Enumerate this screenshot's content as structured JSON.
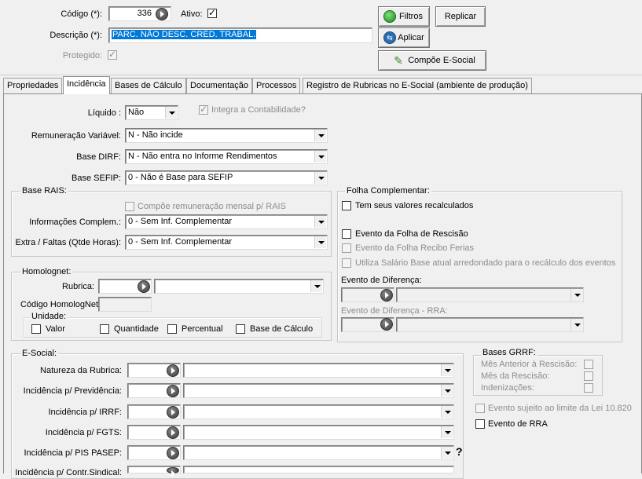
{
  "header": {
    "codigo_label": "Código (*):",
    "codigo_value": "336",
    "ativo_label": "Ativo:",
    "descricao_label": "Descrição (*):",
    "descricao_value": "PARC. NÃO DESC. CRÉD. TRABAL.",
    "protegido_label": "Protegido:"
  },
  "toolbar": {
    "filtros": "Filtros",
    "aplicar": "Aplicar",
    "replicar": "Replicar",
    "compoe": "Compõe E-Social"
  },
  "tabs": [
    {
      "label": "Propriedades"
    },
    {
      "label": "Incidência"
    },
    {
      "label": "Bases de Cálculo"
    },
    {
      "label": "Documentação"
    },
    {
      "label": "Processos"
    },
    {
      "label": "Registro de Rubricas no E-Social (ambiente de produção)"
    }
  ],
  "incidencia": {
    "liquido_label": "Líquido :",
    "liquido_value": "Não",
    "integra_label": "Integra a Contabilidade?",
    "rem_var_label": "Remuneração Variável:",
    "rem_var_value": "N - Não incide",
    "dirf_label": "Base DIRF:",
    "dirf_value": "N - Não entra no Informe Rendimentos",
    "sefip_label": "Base SEFIP:",
    "sefip_value": "0 - Não é Base para SEFIP"
  },
  "rais": {
    "title": "Base RAIS:",
    "compoe_label": "Compõe remuneração mensal p/ RAIS",
    "info_label": "Informações Complem.:",
    "info_value": "0 - Sem Inf. Complementar",
    "extra_label": "Extra / Faltas (Qtde Horas):",
    "extra_value": "0 - Sem Inf. Complementar"
  },
  "homolognet": {
    "title": "Homolognet:",
    "rubrica_label": "Rubrica:",
    "codigo_label": "Código HomologNet",
    "unidade_title": "Unidade:",
    "valor": "Valor",
    "quantidade": "Quantidade",
    "percentual": "Percentual",
    "base_calculo": "Base de Cálculo"
  },
  "folha": {
    "title": "Folha Complementar:",
    "recalc": "Tem seus valores recalculados",
    "rescisao": "Evento da Folha de Rescisão",
    "recibo": "Evento da Folha Recibo Ferias",
    "salario": "Utiliza Salário Base atual arredondado para o recálculo dos eventos",
    "diferenca_label": "Evento de Diferença:",
    "diferenca_rra_label": "Evento de Diferença - RRA:"
  },
  "esocial": {
    "title": "E-Social:",
    "natureza": "Natureza da Rubrica:",
    "previdencia": "Incidência p/ Previdência:",
    "irrf": "Incidência p/ IRRF:",
    "fgts": "Incidência p/ FGTS:",
    "pis": "Incidência p/ PIS PASEP:",
    "sindical": "Incidência p/ Contr.Sindical:",
    "help": "?"
  },
  "grrf": {
    "title": "Bases GRRF:",
    "mes_anterior": "Mês Anterior à Rescisão:",
    "mes_rescisao": "Mês da Rescisão:",
    "indenizacoes": "Indenizações:"
  },
  "extra": {
    "lei": "Evento sujeito ao limite da Lei 10.820",
    "rra": "Evento de RRA"
  }
}
